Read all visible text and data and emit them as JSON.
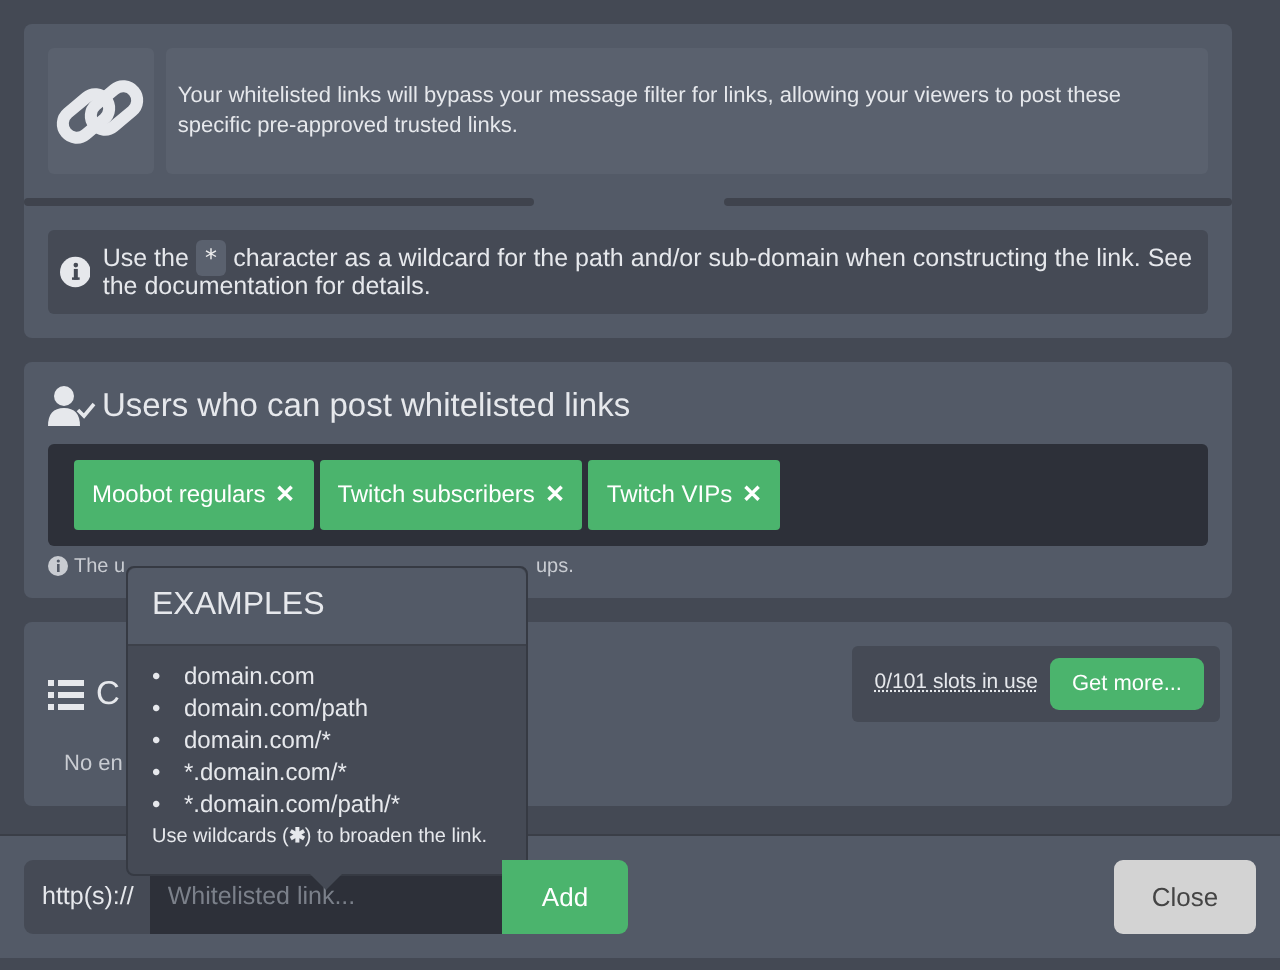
{
  "intro": {
    "text": "Your whitelisted links will bypass your message filter for links, allowing your viewers to post these specific pre-approved trusted links."
  },
  "info": {
    "before": "Use the",
    "code": "*",
    "after": "character as a wildcard for the path and/or sub-domain when constructing the link. See the documentation for details."
  },
  "users": {
    "title": "Users who can post whitelisted links",
    "tags": [
      {
        "label": "Moobot regulars",
        "remove": "✕"
      },
      {
        "label": "Twitch subscribers",
        "remove": "✕"
      },
      {
        "label": "Twitch VIPs",
        "remove": "✕"
      }
    ],
    "help_left": "The u",
    "help_right": "ups."
  },
  "custom": {
    "title": "C",
    "empty": "No en",
    "slots": "0/101 slots in use",
    "get_more": "Get more..."
  },
  "popover": {
    "title": "EXAMPLES",
    "examples": [
      {
        "bullet": "•",
        "text": "domain.com"
      },
      {
        "bullet": "•",
        "text": "domain.com/path"
      },
      {
        "bullet": "•",
        "text": "domain.com/*"
      },
      {
        "bullet": "•",
        "text": "*.domain.com/*"
      },
      {
        "bullet": "•",
        "text": "*.domain.com/path/*"
      }
    ],
    "note": "Use wildcards (**✱**) to broaden the link."
  },
  "footer": {
    "prefix": "http(s)://",
    "placeholder": "Whitelisted link...",
    "add": "Add",
    "close": "Close"
  }
}
